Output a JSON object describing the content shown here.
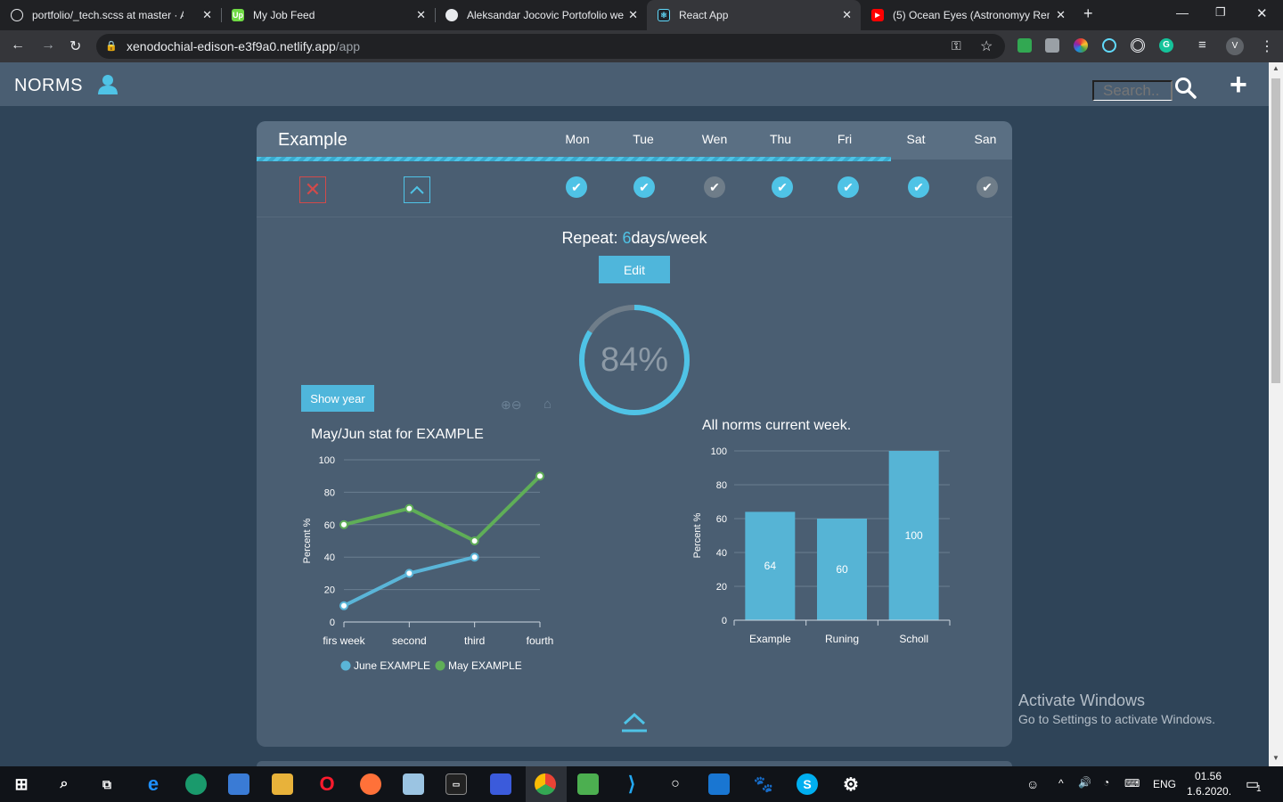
{
  "browser": {
    "tabs": [
      {
        "title": "portfolio/_tech.scss at master · Al",
        "icon": "github-icon",
        "active": false
      },
      {
        "title": "My Job Feed",
        "icon": "upwork-icon",
        "active": false
      },
      {
        "title": "Aleksandar Jocovic Portofolio we",
        "icon": "globe-icon",
        "active": false
      },
      {
        "title": "React App",
        "icon": "react-icon",
        "active": true
      },
      {
        "title": "(5) Ocean Eyes (Astronomyy Rem",
        "icon": "youtube-icon",
        "active": false
      }
    ],
    "new_tab": "+",
    "url_host": "xenodochial-edison-e3f9a0.netlify.app",
    "url_path": "/app",
    "profile_initial": "V"
  },
  "app": {
    "brand": "NORMS",
    "search_placeholder": "Search..",
    "add": "+"
  },
  "norm": {
    "title": "Example",
    "days": [
      {
        "label": "Mon",
        "done": true
      },
      {
        "label": "Tue",
        "done": true
      },
      {
        "label": "Wen",
        "done": false
      },
      {
        "label": "Thu",
        "done": true
      },
      {
        "label": "Fri",
        "done": true
      },
      {
        "label": "Sat",
        "done": true
      },
      {
        "label": "San",
        "done": false
      }
    ],
    "repeat_prefix": "Repeat:",
    "repeat_count": "6",
    "repeat_suffix": "days/week",
    "edit_label": "Edit",
    "progress_text": "84%",
    "progress_value": 0.84,
    "week_progress": 0.84,
    "show_year_label": "Show year"
  },
  "chart_data": [
    {
      "type": "line",
      "title": "May/Jun stat for EXAMPLE",
      "ylabel": "Percent %",
      "xlabel": "",
      "categories": [
        "firs week",
        "second",
        "third",
        "fourth"
      ],
      "ylim": [
        0,
        100
      ],
      "yticks": [
        "0",
        "20",
        "40",
        "60",
        "80",
        "100"
      ],
      "series": [
        {
          "name": "June EXAMPLE",
          "values": [
            10,
            30,
            40,
            null
          ],
          "color": "#5ab5d8"
        },
        {
          "name": "May EXAMPLE",
          "values": [
            60,
            70,
            50,
            90
          ],
          "color": "#5fae57"
        }
      ],
      "legend": "bottom",
      "grid": true
    },
    {
      "type": "bar",
      "title": "All norms current week.",
      "ylabel": "Percent %",
      "xlabel": "",
      "categories": [
        "Example",
        "Runing",
        "Scholl"
      ],
      "values": [
        64,
        60,
        100
      ],
      "value_labels": [
        "64",
        "60",
        "100"
      ],
      "ylim": [
        0,
        100
      ],
      "yticks": [
        "0",
        "20",
        "40",
        "60",
        "80",
        "100"
      ],
      "color": "#56b4d5",
      "grid": true
    }
  ],
  "watermark": {
    "line1": "Activate Windows",
    "line2": "Go to Settings to activate Windows."
  },
  "taskbar": {
    "lang": "ENG",
    "time": "01.56",
    "date": "1.6.2020.",
    "notification_count": "1"
  },
  "colors": {
    "page_bg": "#2f4458",
    "card_bg": "#4a5e72",
    "accent": "#4fc3e6",
    "danger": "#d24a4a",
    "done": "#4fc3e6",
    "not_done": "#6f7d89"
  }
}
